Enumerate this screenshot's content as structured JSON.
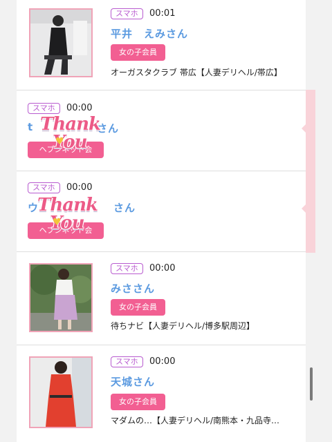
{
  "entries": [
    {
      "badge": "スマホ",
      "time": "00:01",
      "name": "平井　えみさん",
      "member_type": "女の子会員",
      "shop": "オーガスタクラブ 帯広【人妻デリヘル/帯広】"
    },
    {
      "badge": "スマホ",
      "time": "00:00",
      "name": "t",
      "name_suffix": "さん",
      "member_type": "ヘブンネット会員",
      "stamp_line1": "Thank",
      "stamp_line2": "You"
    },
    {
      "badge": "スマホ",
      "time": "00:00",
      "name": "ウ",
      "name_suffix": "さん",
      "member_type": "ヘブンネット会員",
      "stamp_line1": "Thank",
      "stamp_line2": "You"
    },
    {
      "badge": "スマホ",
      "time": "00:00",
      "name": "みささん",
      "member_type": "女の子会員",
      "shop": "待ちナビ【人妻デリヘル/博多駅周辺】"
    },
    {
      "badge": "スマホ",
      "time": "00:00",
      "name": "天城さん",
      "member_type": "女の子会員",
      "shop": "マダムの…【人妻デリヘル/南熊本・九品寺…"
    }
  ],
  "colors": {
    "accent_pink": "#f25f92",
    "name_blue": "#5b9ae0",
    "badge_purple": "#b85acf"
  }
}
